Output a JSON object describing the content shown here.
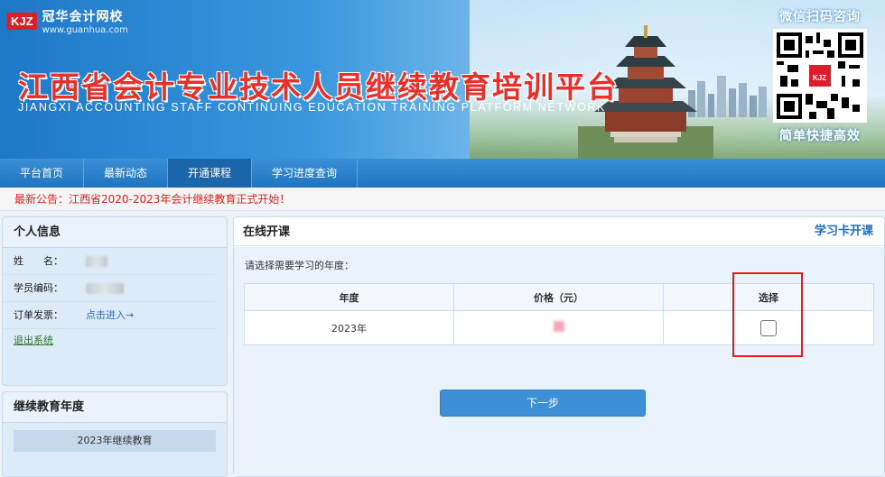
{
  "header": {
    "logo_badge": "KJZ",
    "logo_name": "冠华会计网校",
    "logo_url": "www.guanhua.com",
    "title_cn": "江西省会计专业技术人员继续教育培训平台",
    "title_en": "JIANGXI ACCOUNTING STAFF CONTINUING EDUCATION TRAINING PLATFORM NETWORK",
    "qr_title": "微信扫码咨询",
    "qr_badge": "KJZ",
    "qr_caption": "简单快捷高效"
  },
  "nav": {
    "items": [
      {
        "label": "平台首页"
      },
      {
        "label": "最新动态"
      },
      {
        "label": "开通课程"
      },
      {
        "label": "学习进度查询"
      }
    ],
    "active_index": 2
  },
  "notice": {
    "text": "最新公告：江西省2020-2023年会计继续教育正式开始！"
  },
  "personal_info": {
    "title": "个人信息",
    "name_label": "姓　　名：",
    "student_id_label": "学员编码：",
    "invoice_label": "订单发票：",
    "invoice_link": "点击进入→",
    "logout": "退出系统"
  },
  "year_panel": {
    "title": "继续教育年度",
    "items": [
      "2023年继续教育"
    ]
  },
  "main": {
    "title": "在线开课",
    "study_card_link": "学习卡开课",
    "prompt": "请选择需要学习的年度：",
    "table": {
      "headers": [
        "年度",
        "价格（元）",
        "选择"
      ],
      "rows": [
        {
          "year": "2023年",
          "checked": false
        }
      ]
    },
    "next_button": "下一步"
  },
  "colors": {
    "nav_bg": "#1f74c0",
    "notice_text": "#e0201a",
    "title_red": "#e8302a",
    "highlight_border": "#e02020",
    "button_bg": "#3d8fd7"
  }
}
